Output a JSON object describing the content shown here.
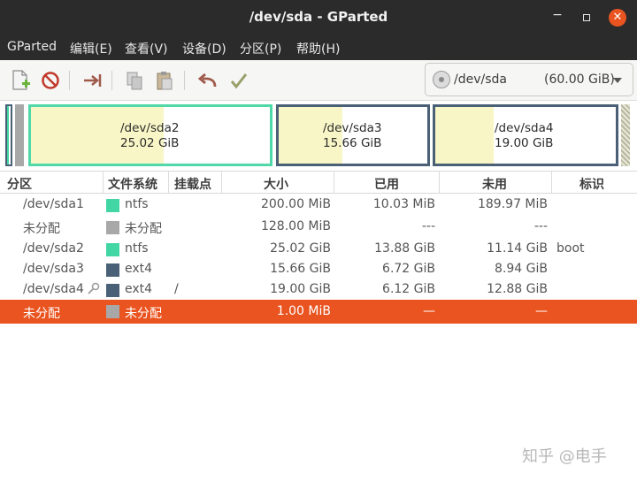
{
  "window": {
    "title": "/dev/sda - GParted",
    "minimize": "−",
    "close": "✕"
  },
  "menu": [
    "GParted",
    "编辑(E)",
    "查看(V)",
    "设备(D)",
    "分区(P)",
    "帮助(H)"
  ],
  "toolbar": {
    "buttons": [
      "new-icon",
      "delete-icon",
      "resize-move-icon",
      "copy-icon",
      "paste-icon",
      "undo-icon",
      "apply-icon"
    ]
  },
  "device_selector": {
    "device": "/dev/sda",
    "size": "(60.00 GiB)"
  },
  "disk_map": {
    "partitions": [
      {
        "name": "/dev/sda2",
        "size": "25.02 GiB",
        "used_fraction": 0.555
      },
      {
        "name": "/dev/sda3",
        "size": "15.66 GiB",
        "used_fraction": 0.429
      },
      {
        "name": "/dev/sda4",
        "size": "19.00 GiB",
        "used_fraction": 0.322
      }
    ]
  },
  "table": {
    "headers": [
      "分区",
      "文件系统",
      "挂载点",
      "大小",
      "已用",
      "未用",
      "标识"
    ],
    "rows": [
      {
        "partition": "/dev/sda1",
        "fs": "ntfs",
        "fs_color": "#42d6a4",
        "mount": "",
        "size": "200.00 MiB",
        "used": "10.03 MiB",
        "unused": "189.97 MiB",
        "flags": "",
        "selected": false
      },
      {
        "partition": "未分配",
        "fs": "未分配",
        "fs_color": "#a8a8a8",
        "mount": "",
        "size": "128.00 MiB",
        "used": "---",
        "unused": "---",
        "flags": "",
        "selected": false
      },
      {
        "partition": "/dev/sda2",
        "fs": "ntfs",
        "fs_color": "#42d6a4",
        "mount": "",
        "size": "25.02 GiB",
        "used": "13.88 GiB",
        "unused": "11.14 GiB",
        "flags": "boot",
        "selected": false
      },
      {
        "partition": "/dev/sda3",
        "fs": "ext4",
        "fs_color": "#4a6076",
        "mount": "",
        "size": "15.66 GiB",
        "used": "6.72 GiB",
        "unused": "8.94 GiB",
        "flags": "",
        "selected": false
      },
      {
        "partition": "/dev/sda4",
        "fs": "ext4",
        "fs_color": "#4a6076",
        "mount": "/",
        "size": "19.00 GiB",
        "used": "6.12 GiB",
        "unused": "12.88 GiB",
        "flags": "",
        "selected": false
      },
      {
        "partition": "未分配",
        "fs": "未分配",
        "fs_color": "#a8a8a8",
        "mount": "",
        "size": "1.00 MiB",
        "used": "—",
        "unused": "—",
        "flags": "",
        "selected": true
      }
    ]
  },
  "watermark": "知乎 @电手"
}
